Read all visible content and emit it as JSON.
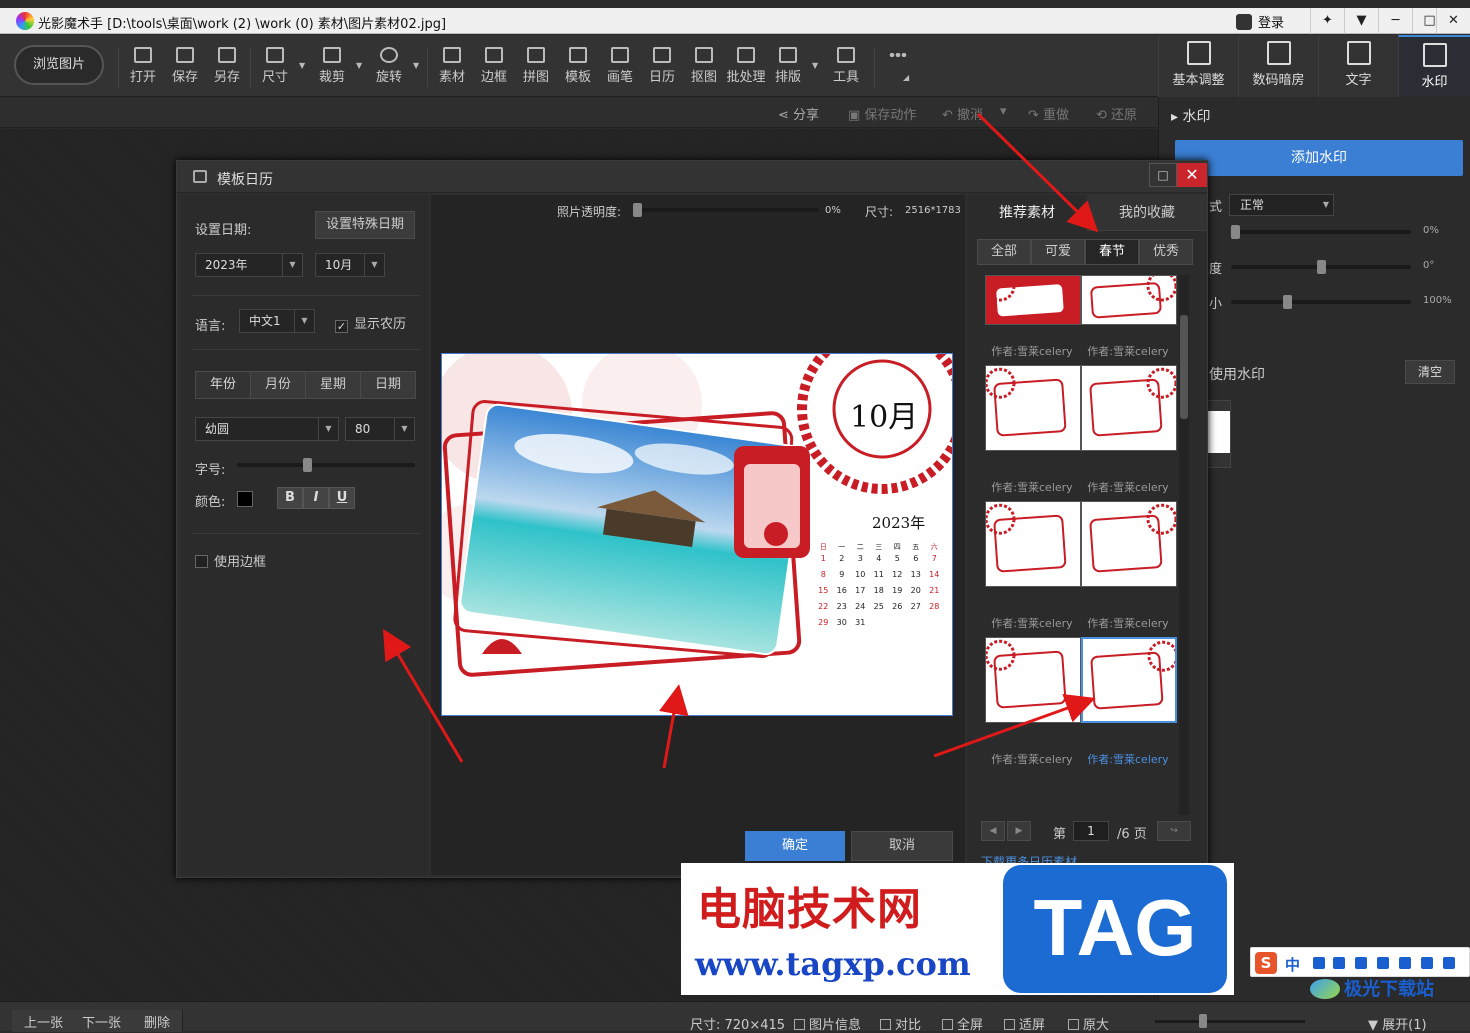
{
  "app": {
    "name": "光影魔术手",
    "path": "[D:\\tools\\桌面\\work (2) \\work (0) 素材\\图片素材02.jpg]",
    "login": "登录"
  },
  "toolbar": {
    "browse": "浏览图片",
    "tools": [
      "打开",
      "保存",
      "另存",
      "尺寸",
      "裁剪",
      "旋转",
      "素材",
      "边框",
      "拼图",
      "模板",
      "画笔",
      "日历",
      "抠图",
      "批处理",
      "排版",
      "工具"
    ]
  },
  "right_tabs": [
    "基本调整",
    "数码暗房",
    "文字",
    "水印"
  ],
  "actions": {
    "share": "分享",
    "save_action": "保存动作",
    "undo": "撤消",
    "redo": "重做",
    "restore": "还原"
  },
  "watermark_panel": {
    "title": "水印",
    "add": "添加水印",
    "mode_label": "式",
    "mode_value": "正常",
    "opacity_value": "0%",
    "rotate_label": "度",
    "rotate_value": "0°",
    "size_label": "小",
    "size_value": "100%",
    "used_label": "使用水印",
    "clear": "清空",
    "opacity_level": 0.0,
    "rotate_level": 0.5,
    "size_level": 0.3
  },
  "dialog": {
    "title": "模板日历",
    "set_date_label": "设置日期:",
    "special_date": "设置特殊日期",
    "year": "2023年",
    "month": "10月",
    "language_label": "语言:",
    "language": "中文1",
    "show_lunar": "显示农历",
    "tabs": [
      "年份",
      "月份",
      "星期",
      "日期"
    ],
    "font": "幼圆",
    "font_size": "80",
    "size_label": "字号:",
    "color_label": "颜色:",
    "format": {
      "bold": "B",
      "italic": "I",
      "underline": "U"
    },
    "use_border": "使用边框",
    "photo_opacity_label": "照片透明度:",
    "photo_opacity": "0%",
    "size_info_label": "尺寸:",
    "size_info": "2516*1783",
    "ok": "确定",
    "cancel": "取消",
    "calendar": {
      "month": "10月",
      "year": "2023年",
      "weekdays": [
        "日",
        "一",
        "二",
        "三",
        "四",
        "五",
        "六"
      ],
      "days": [
        [
          "1",
          "2",
          "3",
          "4",
          "5",
          "6",
          "7"
        ],
        [
          "8",
          "9",
          "10",
          "11",
          "12",
          "13",
          "14"
        ],
        [
          "15",
          "16",
          "17",
          "18",
          "19",
          "20",
          "21"
        ],
        [
          "22",
          "23",
          "24",
          "25",
          "26",
          "27",
          "28"
        ],
        [
          "29",
          "30",
          "31",
          "",
          "",
          "",
          ""
        ]
      ]
    },
    "gallery": {
      "tabs": [
        "推荐素材",
        "我的收藏"
      ],
      "filters": [
        "全部",
        "可爱",
        "春节",
        "优秀"
      ],
      "author": "作者:雪莱celery",
      "page_label": "第",
      "page": "1",
      "total": "/6 页",
      "more": "下载更多日历素材"
    }
  },
  "status": {
    "prev": "上一张",
    "next": "下一张",
    "delete": "删除",
    "size": "尺寸: 720×415",
    "info": "图片信息",
    "compare": "对比",
    "fullscreen": "全屏",
    "fit": "适屏",
    "actual": "原大",
    "expand": "展开(1)",
    "zoom_level": 0.3
  },
  "overlay": {
    "site_cn": "电脑技术网",
    "site_url": "www.tagxp.com",
    "tag": "TAG",
    "ime": "中",
    "brand": "极光下载站"
  }
}
